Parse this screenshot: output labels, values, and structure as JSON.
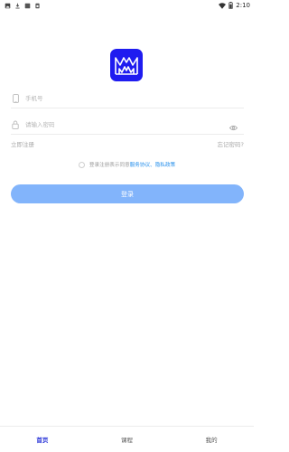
{
  "status_bar": {
    "time": "2:10",
    "left_icons": [
      "image-icon",
      "download-icon",
      "box-icon",
      "sim-icon"
    ],
    "right_icons": [
      "wifi-icon",
      "battery-icon"
    ]
  },
  "logo": {
    "icon": "logo-m-icon",
    "color": "#1f1cf0"
  },
  "login_form": {
    "phone_placeholder": "手机号",
    "password_placeholder": "请输入密码",
    "register_link": "立即注册",
    "forgot_link": "忘记密码?",
    "agreement_prefix": "登录注册表示同意",
    "service_link": "服务协议",
    "separator": "、",
    "privacy_link": "隐私政策",
    "login_button": "登录",
    "button_color": "#82b4fb"
  },
  "bottom_nav": {
    "items": [
      {
        "label": "首页",
        "active": true
      },
      {
        "label": "课程",
        "active": false
      },
      {
        "label": "我的",
        "active": false
      }
    ],
    "active_color": "#2a35d8"
  }
}
